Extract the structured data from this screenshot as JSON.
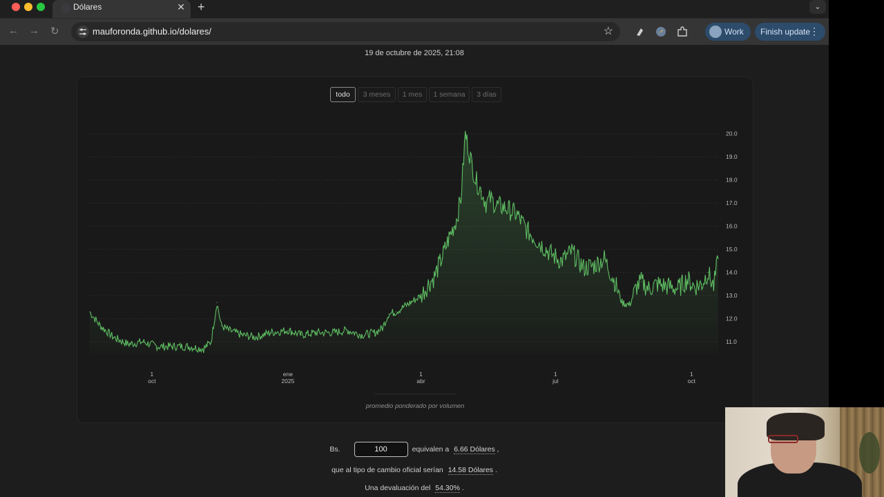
{
  "browser": {
    "tab_title": "Dólares",
    "url": "mauforonda.github.io/dolares/",
    "profile_label": "Work",
    "update_label": "Finish update"
  },
  "page": {
    "timestamp": "19 de octubre de 2025, 21:08",
    "ranges": [
      "todo",
      "3 meses",
      "1 mes",
      "1 semana",
      "3 días"
    ],
    "active_range": "todo",
    "chart_note": "promedio ponderado por volumen"
  },
  "converter": {
    "prefix": "Bs.",
    "amount": "100",
    "equivalen_text": "equivalen a",
    "usd_value": "6.66 Dólares",
    "official_text": "que al tipo de cambio oficial serían",
    "official_value": "14.58 Dólares",
    "deval_text": "Una devaluación del",
    "deval_value": "54.30%"
  },
  "chart_data": {
    "type": "area",
    "title": "",
    "xlabel": "",
    "ylabel": "",
    "ylim": [
      10.5,
      20.2
    ],
    "yticks": [
      "20.0",
      "19.0",
      "18.0",
      "17.0",
      "16.0",
      "15.0",
      "14.0",
      "13.0",
      "12.0",
      "11.0"
    ],
    "xticks": [
      {
        "date": "2024-10-01",
        "line1": "1",
        "line2": "oct"
      },
      {
        "date": "2025-01-01",
        "line1": "ene",
        "line2": "2025"
      },
      {
        "date": "2025-04-01",
        "line1": "1",
        "line2": "abr"
      },
      {
        "date": "2025-07-01",
        "line1": "1",
        "line2": "jul"
      },
      {
        "date": "2025-10-01",
        "line1": "1",
        "line2": "oct"
      }
    ],
    "grid": true,
    "color": "#5fbf63",
    "series": [
      {
        "x": [
          "2024-08-20",
          "2024-08-27",
          "2024-09-05",
          "2024-09-15",
          "2024-09-25",
          "2024-10-05",
          "2024-10-15",
          "2024-10-25",
          "2024-11-05",
          "2024-11-10",
          "2024-11-14",
          "2024-11-17",
          "2024-11-22",
          "2024-12-01",
          "2024-12-10",
          "2024-12-20",
          "2025-01-01",
          "2025-01-10",
          "2025-01-20",
          "2025-02-01",
          "2025-02-10",
          "2025-02-20",
          "2025-03-01",
          "2025-03-06",
          "2025-03-10",
          "2025-03-15",
          "2025-03-20",
          "2025-03-25",
          "2025-04-01",
          "2025-04-06",
          "2025-04-10",
          "2025-04-15",
          "2025-04-20",
          "2025-04-25",
          "2025-04-28",
          "2025-05-01",
          "2025-05-05",
          "2025-05-08",
          "2025-05-12",
          "2025-05-15",
          "2025-05-18",
          "2025-05-22",
          "2025-05-28",
          "2025-06-05",
          "2025-06-12",
          "2025-06-20",
          "2025-06-28",
          "2025-07-05",
          "2025-07-12",
          "2025-07-20",
          "2025-07-27",
          "2025-08-03",
          "2025-08-10",
          "2025-08-15",
          "2025-08-20",
          "2025-08-25",
          "2025-08-28",
          "2025-09-02",
          "2025-09-08",
          "2025-09-15",
          "2025-09-22",
          "2025-09-28",
          "2025-10-03",
          "2025-10-08",
          "2025-10-12",
          "2025-10-16",
          "2025-10-19"
        ],
        "values": [
          12.3,
          11.7,
          11.2,
          10.9,
          11.0,
          10.8,
          10.8,
          10.8,
          10.7,
          11.0,
          12.7,
          11.7,
          11.5,
          11.3,
          11.2,
          11.4,
          11.5,
          11.3,
          11.4,
          11.4,
          11.5,
          11.3,
          11.4,
          11.6,
          12.2,
          12.3,
          12.5,
          12.7,
          13.0,
          13.5,
          13.8,
          14.6,
          15.5,
          16.3,
          17.2,
          20.0,
          18.8,
          18.0,
          17.5,
          17.0,
          17.2,
          16.9,
          16.8,
          16.5,
          15.8,
          15.3,
          14.8,
          14.5,
          14.9,
          14.2,
          14.3,
          14.6,
          13.6,
          12.7,
          12.6,
          13.4,
          13.6,
          13.3,
          13.5,
          13.4,
          13.3,
          13.7,
          13.4,
          13.5,
          14.0,
          13.4,
          14.6
        ]
      }
    ]
  }
}
